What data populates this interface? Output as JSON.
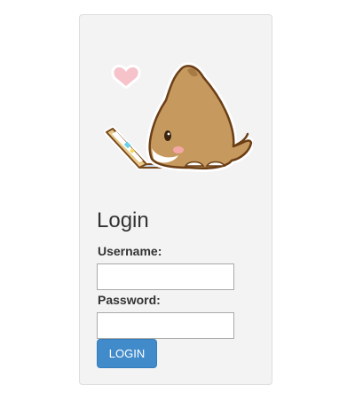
{
  "login_form": {
    "title": "Login",
    "username_label": "Username:",
    "username_value": "",
    "password_label": "Password:",
    "password_value": "",
    "submit_label": "LOGIN"
  },
  "colors": {
    "card_background": "#f3f3f3",
    "button_background": "#428bca",
    "button_text": "#ffffff"
  },
  "icons": {
    "mascot": "dog-using-laptop-illustration",
    "heart": "heart-icon"
  }
}
